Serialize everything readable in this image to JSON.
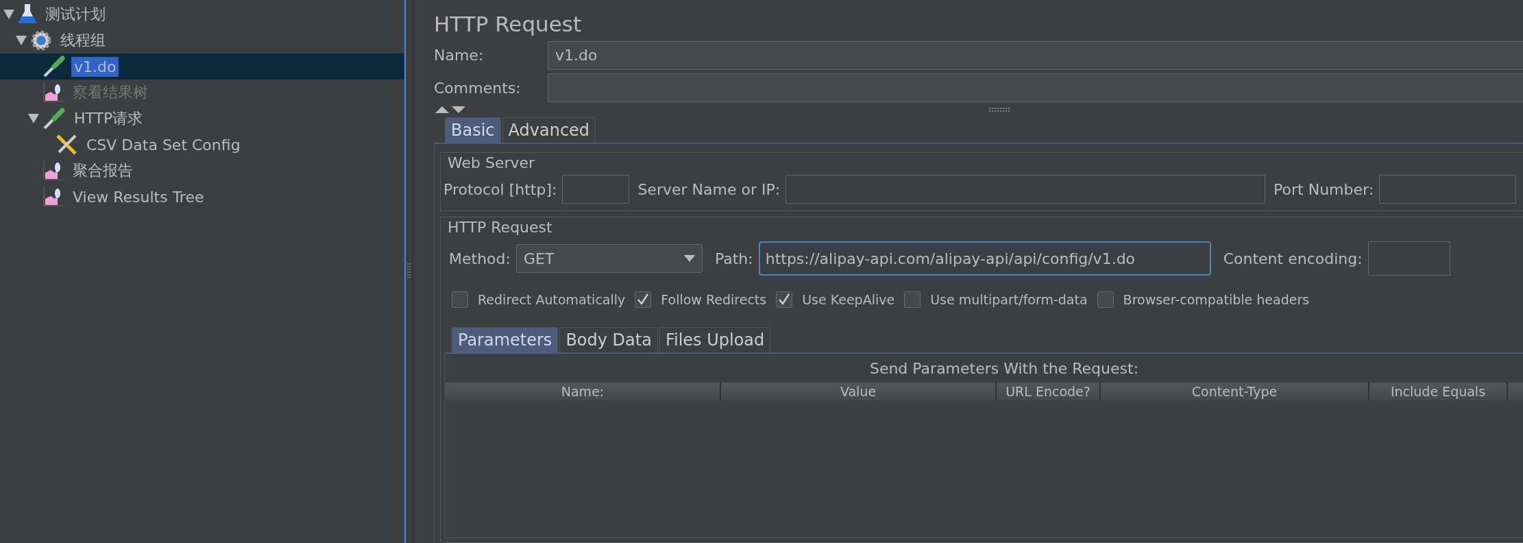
{
  "tree": [
    {
      "label": "测试计划",
      "kind": "flask",
      "expanded": true,
      "selected": false,
      "disabled": false,
      "children": [
        {
          "label": "线程组",
          "kind": "gear",
          "expanded": true,
          "selected": false,
          "disabled": false,
          "children": [
            {
              "label": "v1.do",
              "kind": "pipette",
              "selected": true,
              "disabled": false
            },
            {
              "label": "察看结果树",
              "kind": "chart",
              "selected": false,
              "disabled": true
            },
            {
              "label": "HTTP请求",
              "kind": "pipette",
              "expanded": true,
              "selected": false,
              "disabled": false,
              "children": [
                {
                  "label": "CSV Data Set Config",
                  "kind": "tools",
                  "selected": false,
                  "disabled": false
                }
              ]
            },
            {
              "label": "聚合报告",
              "kind": "chart",
              "selected": false,
              "disabled": false
            },
            {
              "label": "View Results Tree",
              "kind": "chart",
              "selected": false,
              "disabled": false
            }
          ]
        }
      ]
    }
  ],
  "panel_title": "HTTP Request",
  "name": {
    "label": "Name:",
    "value": "v1.do"
  },
  "comments": {
    "label": "Comments:"
  },
  "tabs": [
    {
      "label": "Basic",
      "selected": true
    },
    {
      "label": "Advanced",
      "selected": false
    }
  ],
  "web_server": {
    "title": "Web Server",
    "protocol_label": "Protocol [http]:",
    "server_label": "Server Name or IP:",
    "port_label": "Port Number:"
  },
  "http_request": {
    "title": "HTTP Request",
    "method_label": "Method:",
    "method": "GET",
    "path_label": "Path:",
    "path": "https://alipay-api.com/alipay-api/api/config/v1.do",
    "encoding_label": "Content encoding:"
  },
  "options": [
    {
      "label": "Redirect Automatically",
      "checked": false
    },
    {
      "label": "Follow Redirects",
      "checked": true
    },
    {
      "label": "Use KeepAlive",
      "checked": true
    },
    {
      "label": "Use multipart/form-data",
      "checked": false
    },
    {
      "label": "Browser-compatible headers",
      "checked": false
    }
  ],
  "sub_tabs": [
    {
      "label": "Parameters",
      "selected": true
    },
    {
      "label": "Body Data",
      "selected": false
    },
    {
      "label": "Files Upload",
      "selected": false
    }
  ],
  "params": {
    "title": "Send Parameters With the Request:",
    "columns": [
      "Name:",
      "Value",
      "URL Encode?",
      "Content-Type",
      "Include Equals"
    ]
  }
}
